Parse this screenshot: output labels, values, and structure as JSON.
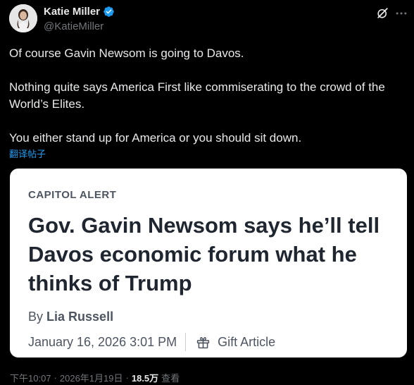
{
  "author": {
    "display_name": "Katie Miller",
    "handle": "@KatieMiller",
    "verified_color": "#1d9bf0"
  },
  "header_icons": {
    "grok": "grok-icon",
    "more": "more-icon"
  },
  "tweet": {
    "paragraphs": [
      "Of course Gavin Newsom is going to Davos.",
      "Nothing quite says America First like commiserating to the crowd of the World’s Elites.",
      "You either stand up for America or you should sit down."
    ],
    "translate_label": "翻译帖子"
  },
  "card": {
    "kicker": "CAPITOL ALERT",
    "headline": "Gov. Gavin Newsom says he’ll tell Davos economic forum what he thinks of Trump",
    "byline_prefix": "By",
    "author": "Lia Russell",
    "date": "January 16, 2026 3:01 PM",
    "gift_label": "Gift Article",
    "background": "#ffffff"
  },
  "footer": {
    "time": "下午10:07",
    "date": "2026年1月19日",
    "separator": "·",
    "views_count": "18.5万",
    "views_label": "查看"
  }
}
